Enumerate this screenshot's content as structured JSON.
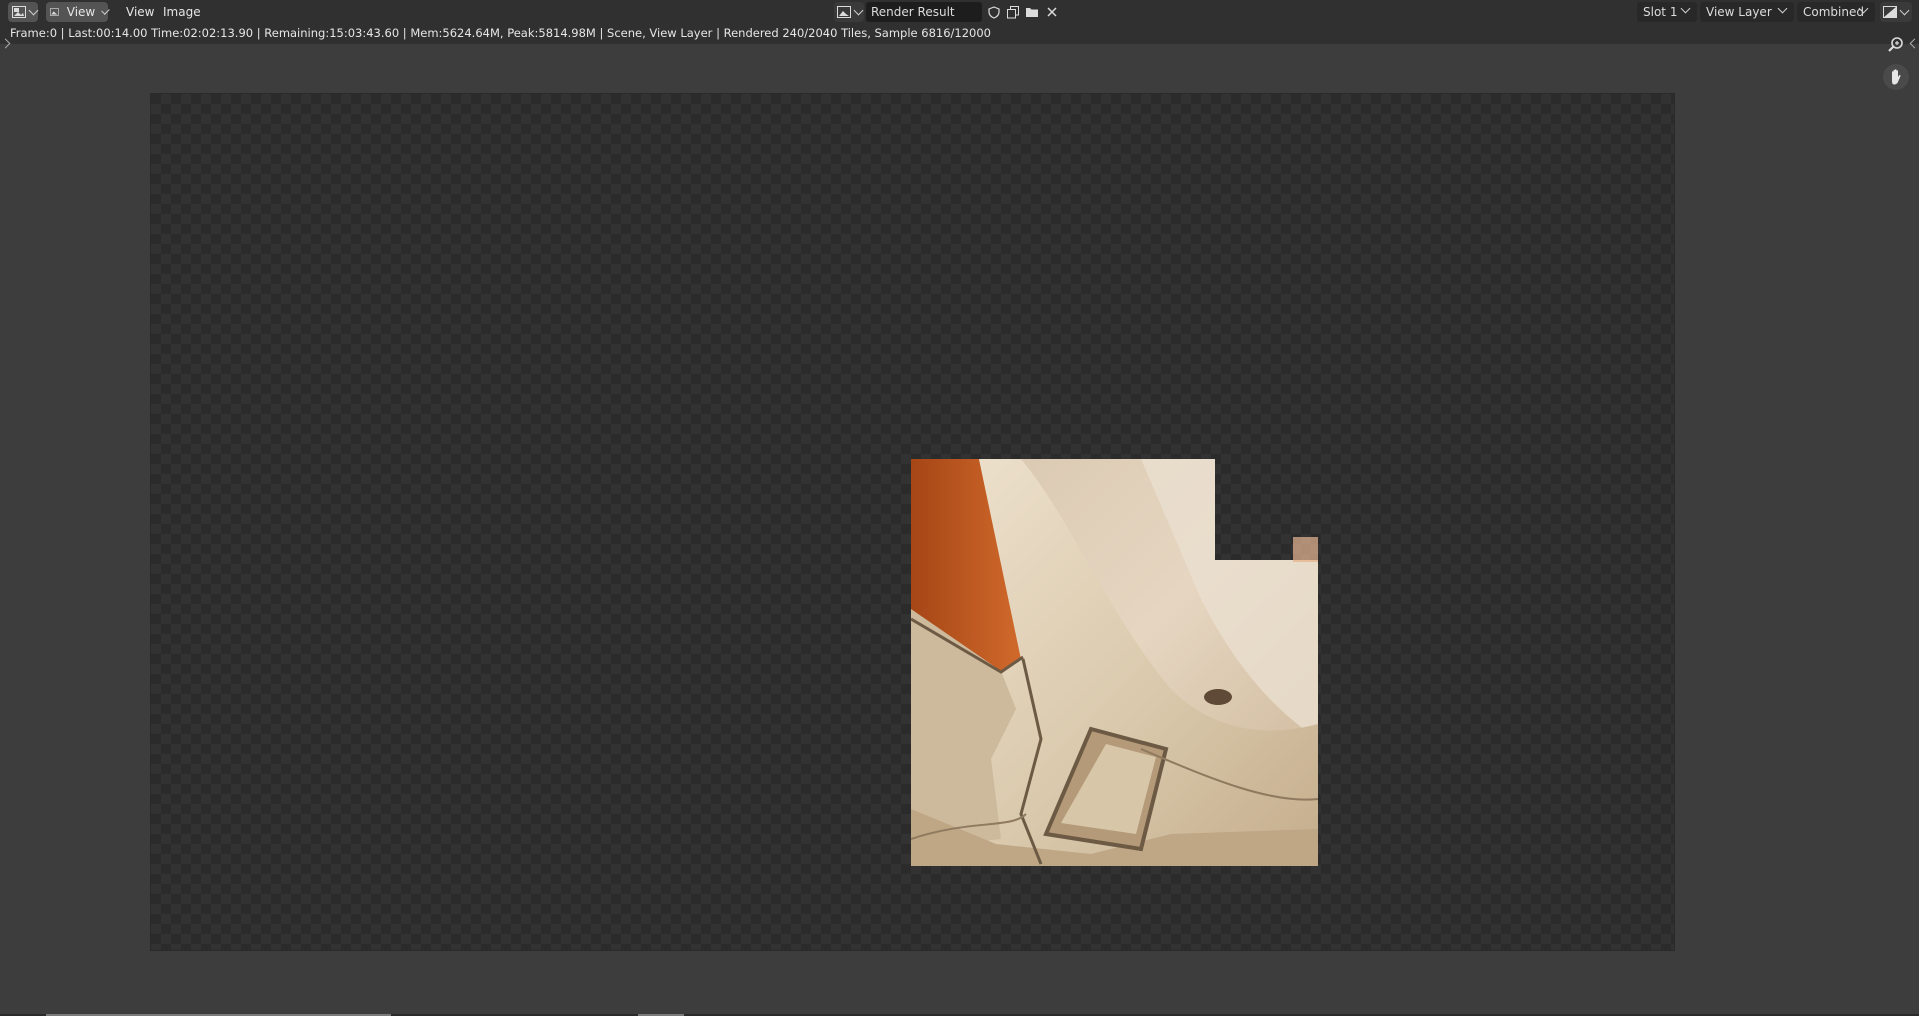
{
  "header": {
    "editor_type_icon": "image-editor-icon",
    "mode_icon": "view-mode-icon",
    "mode_label": "View",
    "menus": [
      "View",
      "Image"
    ],
    "image_browse_icon": "image-browse-icon",
    "image_name": "Render Result",
    "fake_user_icon": "shield-icon",
    "new_image_icon": "duplicate-icon",
    "open_image_icon": "folder-icon",
    "unlink_icon": "close-icon",
    "slot": "Slot 1",
    "layer": "View Layer",
    "pass": "Combined",
    "display_icon": "display-channels-icon"
  },
  "status": {
    "text": "Frame:0 | Last:00:14.00 Time:02:02:13.90 | Remaining:15:03:43.60 | Mem:5624.64M, Peak:5814.98M | Scene, View Layer | Rendered 240/2040 Tiles, Sample 6816/12000"
  },
  "viewport": {
    "zoom_icon": "zoom-icon",
    "pan_icon": "hand-icon",
    "render_progress": {
      "rendered_tiles": 240,
      "total_tiles": 2040,
      "sample": 6816,
      "total_samples": 12000
    }
  },
  "colors": {
    "header_bg": "#303030",
    "viewport_bg": "#3d3d3d",
    "checker_dark": "#2b2b2b",
    "checker_light": "#323232"
  }
}
